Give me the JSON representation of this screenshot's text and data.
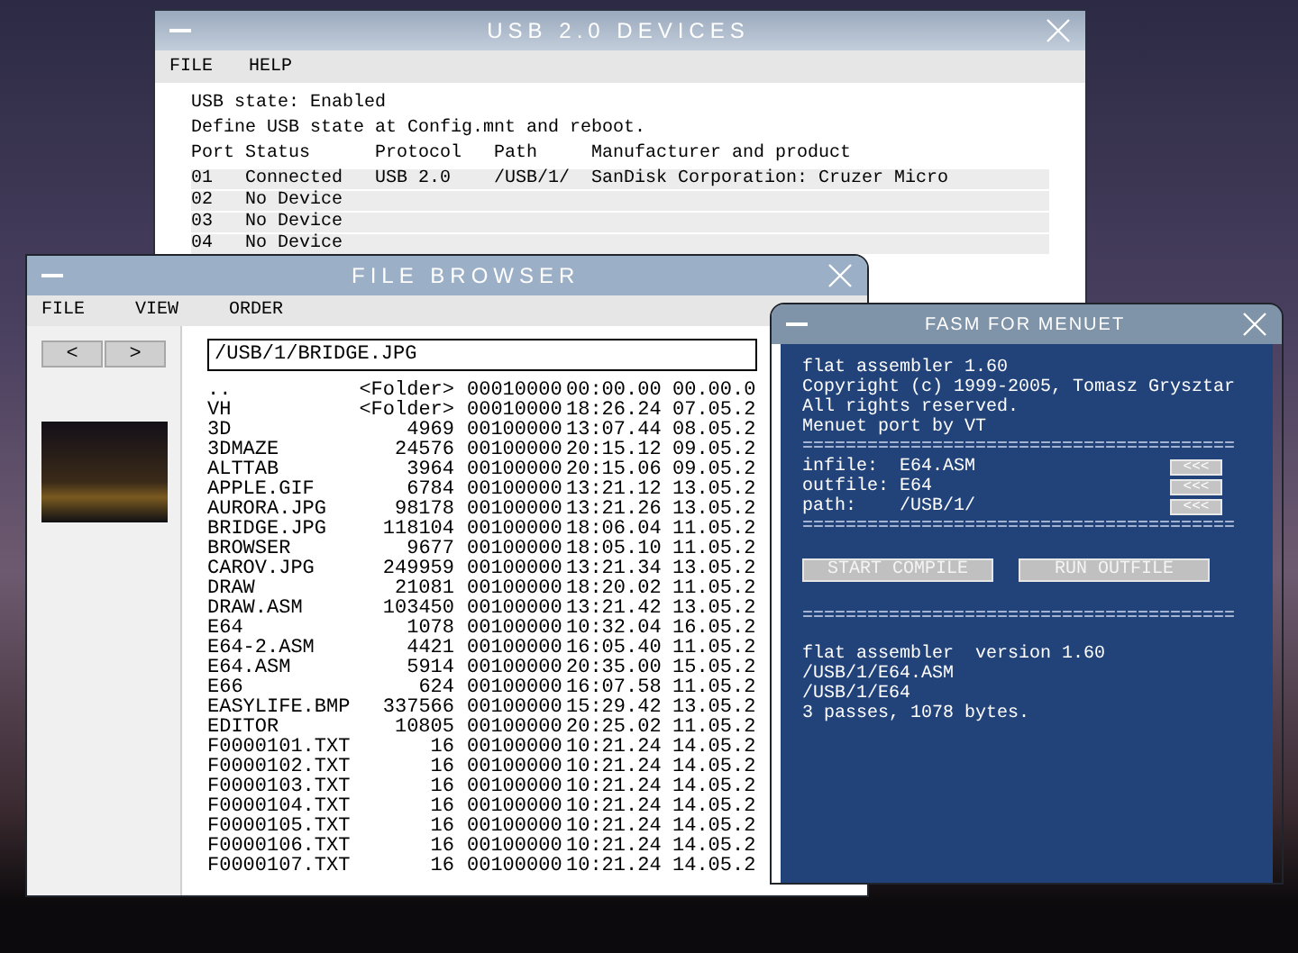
{
  "usb_window": {
    "title": "USB 2.0 DEVICES",
    "menu": [
      "FILE",
      "HELP"
    ],
    "state_text": "USB state: Enabled",
    "hint": "Define USB state at Config.mnt and reboot.",
    "columns": [
      "Port",
      "Status",
      "Protocol",
      "Path",
      "Manufacturer and product"
    ],
    "rows": [
      {
        "port": "01",
        "status": "Connected",
        "protocol": "USB 2.0",
        "path": "/USB/1/",
        "manufacturer": "SanDisk Corporation: Cruzer Micro"
      },
      {
        "port": "02",
        "status": "No Device"
      },
      {
        "port": "03",
        "status": "No Device"
      },
      {
        "port": "04",
        "status": "No Device"
      }
    ]
  },
  "file_browser": {
    "title": "FILE BROWSER",
    "menu": [
      "FILE",
      "VIEW",
      "ORDER"
    ],
    "nav": [
      "<",
      ">"
    ],
    "path_value": "/USB/1/BRIDGE.JPG",
    "files": [
      {
        "name": "..",
        "size": "<Folder>",
        "attributes": "00010000",
        "time": "00:00.00",
        "date": "00.00.0"
      },
      {
        "name": "VH",
        "size": "<Folder>",
        "attributes": "00010000",
        "time": "18:26.24",
        "date": "07.05.2"
      },
      {
        "name": "3D",
        "size": "4969",
        "attributes": "00100000",
        "time": "13:07.44",
        "date": "08.05.2"
      },
      {
        "name": "3DMAZE",
        "size": "24576",
        "attributes": "00100000",
        "time": "20:15.12",
        "date": "09.05.2"
      },
      {
        "name": "ALTTAB",
        "size": "3964",
        "attributes": "00100000",
        "time": "20:15.06",
        "date": "09.05.2"
      },
      {
        "name": "APPLE.GIF",
        "size": "6784",
        "attributes": "00100000",
        "time": "13:21.12",
        "date": "13.05.2"
      },
      {
        "name": "AURORA.JPG",
        "size": "98178",
        "attributes": "00100000",
        "time": "13:21.26",
        "date": "13.05.2"
      },
      {
        "name": "BRIDGE.JPG",
        "size": "118104",
        "attributes": "00100000",
        "time": "18:06.04",
        "date": "11.05.2"
      },
      {
        "name": "BROWSER",
        "size": "9677",
        "attributes": "00100000",
        "time": "18:05.10",
        "date": "11.05.2"
      },
      {
        "name": "CAROV.JPG",
        "size": "249959",
        "attributes": "00100000",
        "time": "13:21.34",
        "date": "13.05.2"
      },
      {
        "name": "DRAW",
        "size": "21081",
        "attributes": "00100000",
        "time": "18:20.02",
        "date": "11.05.2"
      },
      {
        "name": "DRAW.ASM",
        "size": "103450",
        "attributes": "00100000",
        "time": "13:21.42",
        "date": "13.05.2"
      },
      {
        "name": "E64",
        "size": "1078",
        "attributes": "00100000",
        "time": "10:32.04",
        "date": "16.05.2"
      },
      {
        "name": "E64-2.ASM",
        "size": "4421",
        "attributes": "00100000",
        "time": "16:05.40",
        "date": "11.05.2"
      },
      {
        "name": "E64.ASM",
        "size": "5914",
        "attributes": "00100000",
        "time": "20:35.00",
        "date": "15.05.2"
      },
      {
        "name": "E66",
        "size": "624",
        "attributes": "00100000",
        "time": "16:07.58",
        "date": "11.05.2"
      },
      {
        "name": "EASYLIFE.BMP",
        "size": "337566",
        "attributes": "00100000",
        "time": "15:29.42",
        "date": "13.05.2"
      },
      {
        "name": "EDITOR",
        "size": "10805",
        "attributes": "00100000",
        "time": "20:25.02",
        "date": "11.05.2"
      },
      {
        "name": "F0000101.TXT",
        "size": "16",
        "attributes": "00100000",
        "time": "10:21.24",
        "date": "14.05.2"
      },
      {
        "name": "F0000102.TXT",
        "size": "16",
        "attributes": "00100000",
        "time": "10:21.24",
        "date": "14.05.2"
      },
      {
        "name": "F0000103.TXT",
        "size": "16",
        "attributes": "00100000",
        "time": "10:21.24",
        "date": "14.05.2"
      },
      {
        "name": "F0000104.TXT",
        "size": "16",
        "attributes": "00100000",
        "time": "10:21.24",
        "date": "14.05.2"
      },
      {
        "name": "F0000105.TXT",
        "size": "16",
        "attributes": "00100000",
        "time": "10:21.24",
        "date": "14.05.2"
      },
      {
        "name": "F0000106.TXT",
        "size": "16",
        "attributes": "00100000",
        "time": "10:21.24",
        "date": "14.05.2"
      },
      {
        "name": "F0000107.TXT",
        "size": "16",
        "attributes": "00100000",
        "time": "10:21.24",
        "date": "14.05.2"
      }
    ]
  },
  "fasm_window": {
    "title": "FASM FOR MENUET",
    "body": [
      {
        "kind": "text",
        "text": "flat assembler 1.60"
      },
      {
        "kind": "text",
        "text": "Copyright (c) 1999-2005, Tomasz Grysztar"
      },
      {
        "kind": "text",
        "text": "All rights reserved."
      },
      {
        "kind": "text",
        "text": "Menuet port by VT"
      },
      {
        "kind": "rule",
        "text": "========================================"
      },
      {
        "kind": "field",
        "label": "infile:",
        "value": "E64.ASM",
        "button": "<<<"
      },
      {
        "kind": "field",
        "label": "outfile:",
        "value": "E64",
        "button": "<<<"
      },
      {
        "kind": "field",
        "label": "path:",
        "value": "/USB/1/",
        "button": "<<<"
      },
      {
        "kind": "rule",
        "text": "========================================"
      },
      {
        "kind": "buttons",
        "buttons": [
          "START COMPILE",
          "RUN OUTFILE"
        ]
      },
      {
        "kind": "rule",
        "text": "========================================"
      },
      {
        "kind": "text",
        "text": "flat assembler  version 1.60"
      },
      {
        "kind": "text",
        "text": "/USB/1/E64.ASM"
      },
      {
        "kind": "text",
        "text": "/USB/1/E64"
      },
      {
        "kind": "text",
        "text": "3 passes, 1078 bytes."
      }
    ]
  }
}
